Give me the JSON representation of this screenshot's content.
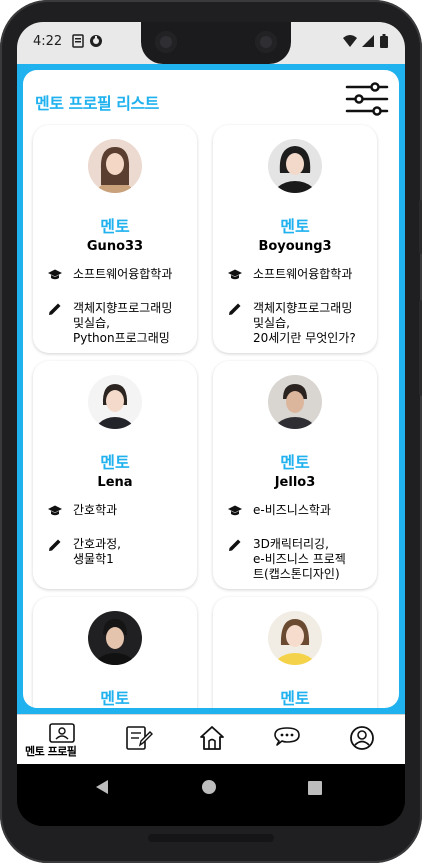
{
  "status_bar": {
    "time": "4:22"
  },
  "header": {
    "title": "멘토 프로필 리스트",
    "filter_icon": "sliders-icon"
  },
  "mentors": [
    {
      "role": "멘토",
      "username": "Guno33",
      "department": "소프트웨어융합학과",
      "courses": "객체지향프로그래밍\n및실습,\nPython프로그래밍"
    },
    {
      "role": "멘토",
      "username": "Boyoung3",
      "department": "소프트웨어융합학과",
      "courses": "객체지향프로그래밍\n및실습,\n20세기란 무엇인가?"
    },
    {
      "role": "멘토",
      "username": "Lena",
      "department": "간호학과",
      "courses": "간호과정,\n생물학1"
    },
    {
      "role": "멘토",
      "username": "Jello3",
      "department": "e-비즈니스학과",
      "courses": "3D캐릭터리깅,\ne-비즈니스 프로젝\n트(캡스톤디자인)"
    },
    {
      "role": "멘토"
    },
    {
      "role": "멘토"
    }
  ],
  "bottom_nav": {
    "items": [
      {
        "label": "멘토 프로필",
        "icon": "profile-card-icon"
      },
      {
        "icon": "edit-note-icon"
      },
      {
        "icon": "home-icon"
      },
      {
        "icon": "chat-icon"
      },
      {
        "icon": "account-icon"
      }
    ]
  },
  "colors": {
    "accent": "#20b1ef",
    "status_bar": "#e9e9ea"
  }
}
